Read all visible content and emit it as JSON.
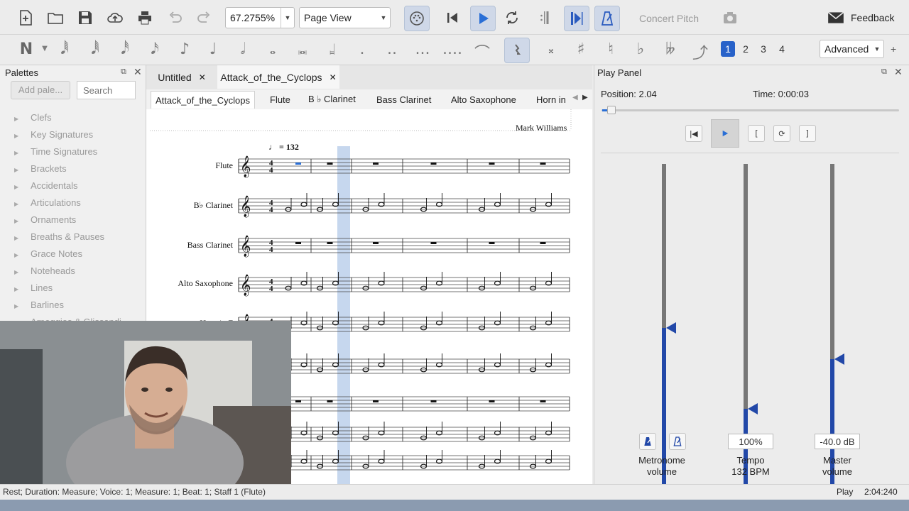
{
  "toolbar": {
    "zoom_value": "67.2755%",
    "view_mode": "Page View",
    "concert_pitch": "Concert Pitch",
    "feedback": "Feedback"
  },
  "note_toolbar": {
    "voices": [
      "1",
      "2",
      "3",
      "4"
    ],
    "workspace": "Advanced",
    "add": "+"
  },
  "palettes": {
    "title": "Palettes",
    "add_button": "Add pale...",
    "search_placeholder": "Search",
    "items": [
      "Clefs",
      "Key Signatures",
      "Time Signatures",
      "Brackets",
      "Accidentals",
      "Articulations",
      "Ornaments",
      "Breaths & Pauses",
      "Grace Notes",
      "Noteheads",
      "Lines",
      "Barlines",
      "Arpeggios & Glissandi"
    ]
  },
  "tabs": {
    "files": [
      "Untitled",
      "Attack_of_the_Cyclops"
    ],
    "parts": [
      "Attack_of_the_Cyclops",
      "Flute",
      "B ♭ Clarinet",
      "Bass Clarinet",
      "Alto Saxophone",
      "Horn in"
    ]
  },
  "score": {
    "composer": "Mark Williams",
    "tempo": "♩ = 132",
    "instruments": [
      "Flute",
      "B♭ Clarinet",
      "Bass Clarinet",
      "Alto Saxophone",
      "Horn in F"
    ]
  },
  "play_panel": {
    "title": "Play Panel",
    "position_label": "Position: 2.04",
    "time_label": "Time: 0:00:03",
    "tempo_value": "100%",
    "master_value": "-40.0 dB",
    "metronome_label": "Metronome",
    "metronome_label2": "volume",
    "tempo_label": "Tempo",
    "tempo_bpm": "132 BPM",
    "master_label": "Master",
    "master_label2": "volume",
    "metronome_level": 0.62,
    "tempo_level": 0.31,
    "master_level": 0.5
  },
  "status": {
    "left_text": "Rest; Duration: Measure; Voice: 1; Measure: 1; Beat: 1; Staff 1 (Flute)",
    "mode": "Play",
    "position": "2:04:240"
  }
}
